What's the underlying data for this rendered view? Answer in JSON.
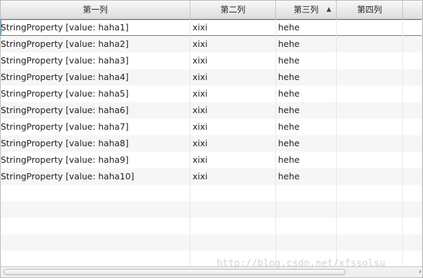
{
  "columns": [
    {
      "label": "第一列",
      "sorted": false
    },
    {
      "label": "第二列",
      "sorted": false
    },
    {
      "label": "第三列",
      "sorted": true,
      "sort_icon": "triangle-up-icon"
    },
    {
      "label": "第四列",
      "sorted": false
    },
    {
      "label": "",
      "sorted": false
    }
  ],
  "rows": [
    {
      "c1": "StringProperty [value: haha1]",
      "c2": "xixi",
      "c3": "hehe",
      "c4": ""
    },
    {
      "c1": "StringProperty [value: haha2]",
      "c2": "xixi",
      "c3": "hehe",
      "c4": ""
    },
    {
      "c1": "StringProperty [value: haha3]",
      "c2": "xixi",
      "c3": "hehe",
      "c4": ""
    },
    {
      "c1": "StringProperty [value: haha4]",
      "c2": "xixi",
      "c3": "hehe",
      "c4": ""
    },
    {
      "c1": "StringProperty [value: haha5]",
      "c2": "xixi",
      "c3": "hehe",
      "c4": ""
    },
    {
      "c1": "StringProperty [value: haha6]",
      "c2": "xixi",
      "c3": "hehe",
      "c4": ""
    },
    {
      "c1": "StringProperty [value: haha7]",
      "c2": "xixi",
      "c3": "hehe",
      "c4": ""
    },
    {
      "c1": "StringProperty [value: haha8]",
      "c2": "xixi",
      "c3": "hehe",
      "c4": ""
    },
    {
      "c1": "StringProperty [value: haha9]",
      "c2": "xixi",
      "c3": "hehe",
      "c4": ""
    },
    {
      "c1": "StringProperty [value: haha10]",
      "c2": "xixi",
      "c3": "hehe",
      "c4": ""
    }
  ],
  "empty_rows": 5,
  "selected_row": 0,
  "watermark": "http://blog.csdn.net/xfssolsu",
  "colors": {
    "selection": "#1f8fd9",
    "alt_row": "#f6f6f6"
  },
  "scrollbar": {
    "arrow": "chevron-right-icon"
  }
}
